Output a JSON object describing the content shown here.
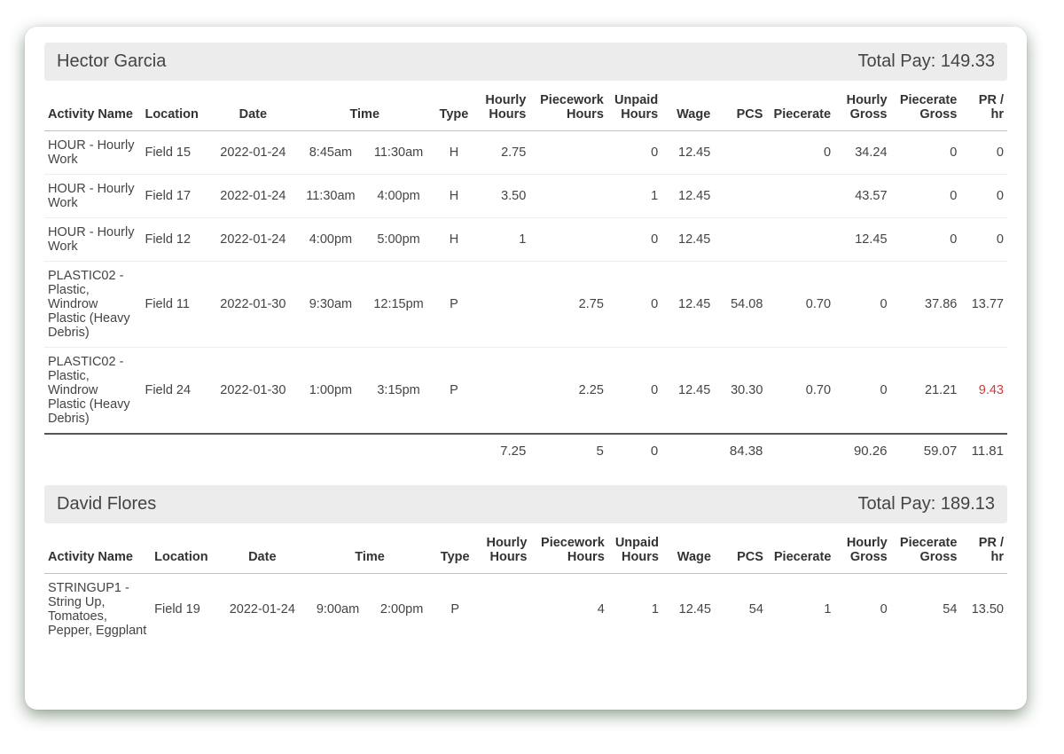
{
  "columns": {
    "activity": "Activity Name",
    "location": "Location",
    "date": "Date",
    "time": "Time",
    "type": "Type",
    "hourly_hours": "Hourly Hours",
    "piecework_hours": "Piecework Hours",
    "unpaid_hours": "Unpaid Hours",
    "wage": "Wage",
    "pcs": "PCS",
    "piecerate": "Piecerate",
    "hourly_gross": "Hourly Gross",
    "piecerate_gross": "Piecerate Gross",
    "pr_hr": "PR / hr"
  },
  "total_pay_label": "Total Pay:",
  "employees": [
    {
      "name": "Hector Garcia",
      "total_pay": "149.33",
      "rows": [
        {
          "activity": "HOUR - Hourly Work",
          "location": "Field 15",
          "date": "2022-01-24",
          "time_start": "8:45am",
          "time_end": "11:30am",
          "type": "H",
          "hourly_hours": "2.75",
          "piecework_hours": "",
          "unpaid_hours": "0",
          "wage": "12.45",
          "pcs": "",
          "piecerate": "0",
          "hourly_gross": "34.24",
          "piecerate_gross": "0",
          "pr_hr": "0",
          "pr_hr_neg": false
        },
        {
          "activity": "HOUR - Hourly Work",
          "location": "Field 17",
          "date": "2022-01-24",
          "time_start": "11:30am",
          "time_end": "4:00pm",
          "type": "H",
          "hourly_hours": "3.50",
          "piecework_hours": "",
          "unpaid_hours": "1",
          "wage": "12.45",
          "pcs": "",
          "piecerate": "",
          "hourly_gross": "43.57",
          "piecerate_gross": "0",
          "pr_hr": "0",
          "pr_hr_neg": false
        },
        {
          "activity": "HOUR - Hourly Work",
          "location": "Field 12",
          "date": "2022-01-24",
          "time_start": "4:00pm",
          "time_end": "5:00pm",
          "type": "H",
          "hourly_hours": "1",
          "piecework_hours": "",
          "unpaid_hours": "0",
          "wage": "12.45",
          "pcs": "",
          "piecerate": "",
          "hourly_gross": "12.45",
          "piecerate_gross": "0",
          "pr_hr": "0",
          "pr_hr_neg": false
        },
        {
          "activity": "PLASTIC02 - Plastic, Windrow Plastic (Heavy Debris)",
          "location": "Field 11",
          "date": "2022-01-30",
          "time_start": "9:30am",
          "time_end": "12:15pm",
          "type": "P",
          "hourly_hours": "",
          "piecework_hours": "2.75",
          "unpaid_hours": "0",
          "wage": "12.45",
          "pcs": "54.08",
          "piecerate": "0.70",
          "hourly_gross": "0",
          "piecerate_gross": "37.86",
          "pr_hr": "13.77",
          "pr_hr_neg": false
        },
        {
          "activity": "PLASTIC02 - Plastic, Windrow Plastic (Heavy Debris)",
          "location": "Field 24",
          "date": "2022-01-30",
          "time_start": "1:00pm",
          "time_end": "3:15pm",
          "type": "P",
          "hourly_hours": "",
          "piecework_hours": "2.25",
          "unpaid_hours": "0",
          "wage": "12.45",
          "pcs": "30.30",
          "piecerate": "0.70",
          "hourly_gross": "0",
          "piecerate_gross": "21.21",
          "pr_hr": "9.43",
          "pr_hr_neg": true
        }
      ],
      "totals": {
        "hourly_hours": "7.25",
        "piecework_hours": "5",
        "unpaid_hours": "0",
        "pcs": "84.38",
        "hourly_gross": "90.26",
        "piecerate_gross": "59.07",
        "pr_hr": "11.81"
      }
    },
    {
      "name": "David Flores",
      "total_pay": "189.13",
      "rows": [
        {
          "activity": "STRINGUP1 - String Up, Tomatoes, Pepper, Eggplant",
          "location": "Field 19",
          "date": "2022-01-24",
          "time_start": "9:00am",
          "time_end": "2:00pm",
          "type": "P",
          "hourly_hours": "",
          "piecework_hours": "4",
          "unpaid_hours": "1",
          "wage": "12.45",
          "pcs": "54",
          "piecerate": "1",
          "hourly_gross": "0",
          "piecerate_gross": "54",
          "pr_hr": "13.50",
          "pr_hr_neg": false
        }
      ],
      "totals": null
    }
  ]
}
